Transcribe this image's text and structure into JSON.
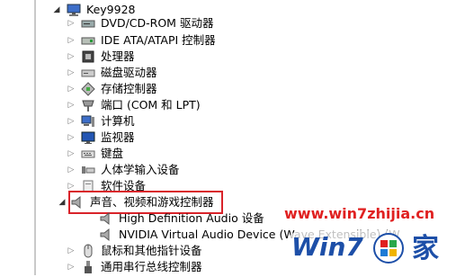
{
  "tree": {
    "root": {
      "label": "Key9928"
    },
    "items": [
      {
        "label": "DVD/CD-ROM 驱动器",
        "icon": "dvd-drive-icon"
      },
      {
        "label": "IDE ATA/ATAPI 控制器",
        "icon": "ide-controller-icon"
      },
      {
        "label": "处理器",
        "icon": "processor-icon"
      },
      {
        "label": "磁盘驱动器",
        "icon": "disk-drive-icon"
      },
      {
        "label": "存储控制器",
        "icon": "storage-controller-icon"
      },
      {
        "label": "端口 (COM 和 LPT)",
        "icon": "port-icon"
      },
      {
        "label": "计算机",
        "icon": "computer-icon"
      },
      {
        "label": "监视器",
        "icon": "monitor-icon"
      },
      {
        "label": "键盘",
        "icon": "keyboard-icon"
      },
      {
        "label": "人体学输入设备",
        "icon": "hid-icon"
      },
      {
        "label": "软件设备",
        "icon": "software-device-icon"
      },
      {
        "label": "声音、视频和游戏控制器",
        "icon": "sound-video-icon",
        "expanded": true
      },
      {
        "label": "High Definition Audio 设备",
        "icon": "audio-device-icon",
        "child": true
      },
      {
        "label": "NVIDIA Virtual Audio Device (Wave Extensible) (W",
        "icon": "audio-device-icon",
        "child": true
      },
      {
        "label": "鼠标和其他指针设备",
        "icon": "mouse-icon"
      },
      {
        "label": "通用串行总线控制器",
        "icon": "usb-icon"
      }
    ]
  },
  "watermark": {
    "url": "www.win7zhijia.cn",
    "logo_text": "Win7",
    "logo_char": "家",
    "colors": {
      "red": "#e02020",
      "blue": "#1d4fa8"
    }
  }
}
